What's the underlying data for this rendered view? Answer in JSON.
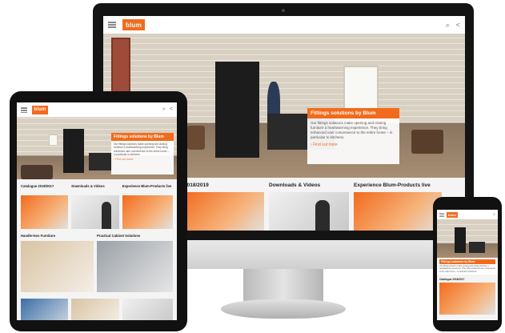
{
  "brand": {
    "logo_text": "blum",
    "accent": "#f26b1d"
  },
  "desktop": {
    "promo": {
      "title": "Fittings solutions by Blum",
      "text": "Our fittings solutions make opening and closing furniture a heartwarming experience. They bring enhanced user convenience to the entire home – in particular to kitchens.",
      "link": "Find out more"
    },
    "tiles": [
      {
        "title": "2018/2019"
      },
      {
        "title": "Downloads & Videos"
      },
      {
        "title": "Experience Blum-Products live"
      }
    ]
  },
  "tablet": {
    "promo": {
      "title": "Fittings solutions by Blum",
      "text": "Our fittings solutions make opening and closing furniture a heartwarming experience. They bring enhanced user convenience to the entire home – in particular to kitchens.",
      "link": "Find out more"
    },
    "tiles_row1": [
      {
        "title": "Catalogue 2018/2017"
      },
      {
        "title": "Downloads & Videos"
      },
      {
        "title": "Experience Blum-Products live"
      }
    ],
    "tiles_row2": [
      {
        "title": "Handle-less Furniture"
      },
      {
        "title": "Practical Cabinet Solutions"
      }
    ]
  },
  "phone": {
    "promo": {
      "title": "Fittings solutions by Blum",
      "text": "Our fittings solutions make opening and closing furniture a heartwarming experience. They bring enhanced user convenience to the entire home – in particular to kitchens."
    },
    "tile_title": "Catalogue 2018/2017"
  }
}
